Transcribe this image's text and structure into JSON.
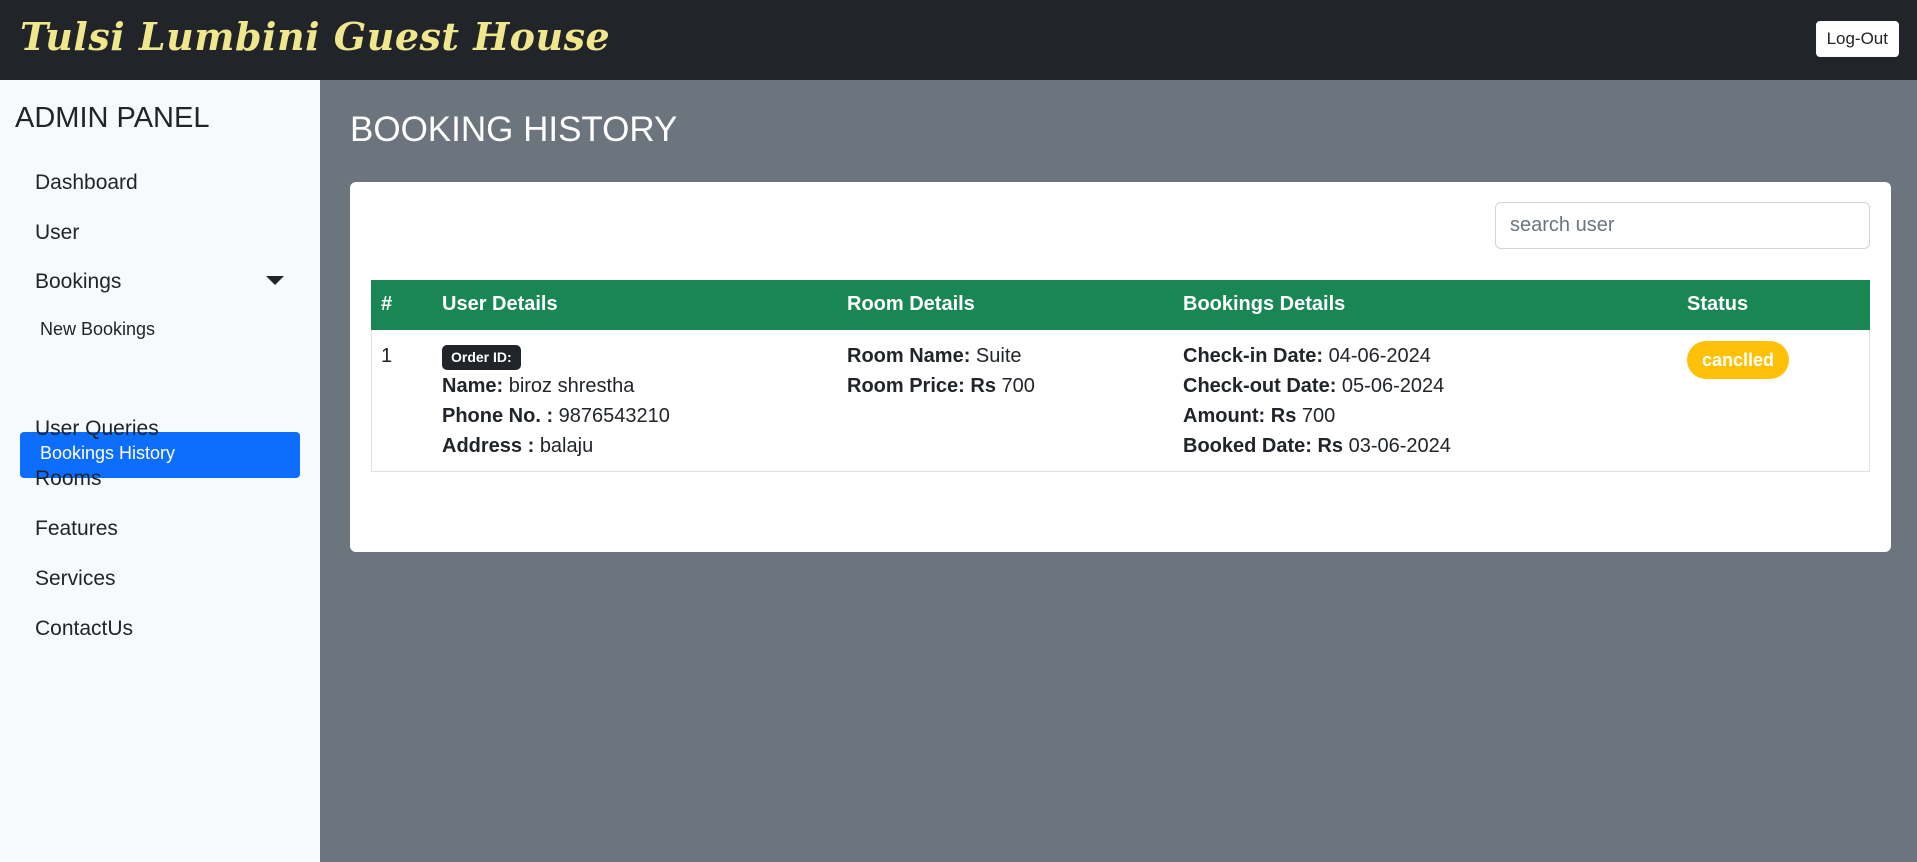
{
  "header": {
    "brand": "Tulsi Lumbini Guest House",
    "logout_label": "Log-Out"
  },
  "sidebar": {
    "title": "ADMIN PANEL",
    "items": {
      "dashboard": "Dashboard",
      "user": "User",
      "bookings": "Bookings",
      "new_bookings": "New Bookings",
      "bookings_history": "Bookings History",
      "user_queries": "User Queries",
      "rooms": "Rooms",
      "features": "Features",
      "services": "Services",
      "contact_us": "ContactUs"
    }
  },
  "main": {
    "page_title": "BOOKING HISTORY",
    "search_placeholder": "search user",
    "table": {
      "headers": [
        "#",
        "User Details",
        "Room Details",
        "Bookings Details",
        "Status"
      ],
      "rows": [
        {
          "index": "1",
          "order_badge": "Order ID:",
          "name_label": "Name:",
          "name": "biroz shrestha",
          "phone_label": "Phone No. :",
          "phone": "9876543210",
          "address_label": "Address :",
          "address": "balaju",
          "room_name_label": "Room Name:",
          "room_name": "Suite",
          "room_price_label": "Room Price:",
          "room_price": "Rs",
          "room_price_value": "700",
          "checkin_label": "Check-in Date:",
          "checkin": "04-06-2024",
          "checkout_label": "Check-out Date:",
          "checkout": "05-06-2024",
          "amount_label": "Amount:",
          "amount_currency": "Rs",
          "amount": "700",
          "booked_label": "Booked Date:",
          "booked_currency": "Rs",
          "booked": "03-06-2024",
          "status": "canclled"
        }
      ]
    }
  },
  "colors": {
    "header_bg": "#212529",
    "brand": "#f0e68c",
    "sidebar_bg": "#f8f9fa",
    "active_item": "#0d6efd",
    "content_bg": "#6c757d",
    "table_header": "#198754",
    "status_badge": "#ffc107"
  }
}
